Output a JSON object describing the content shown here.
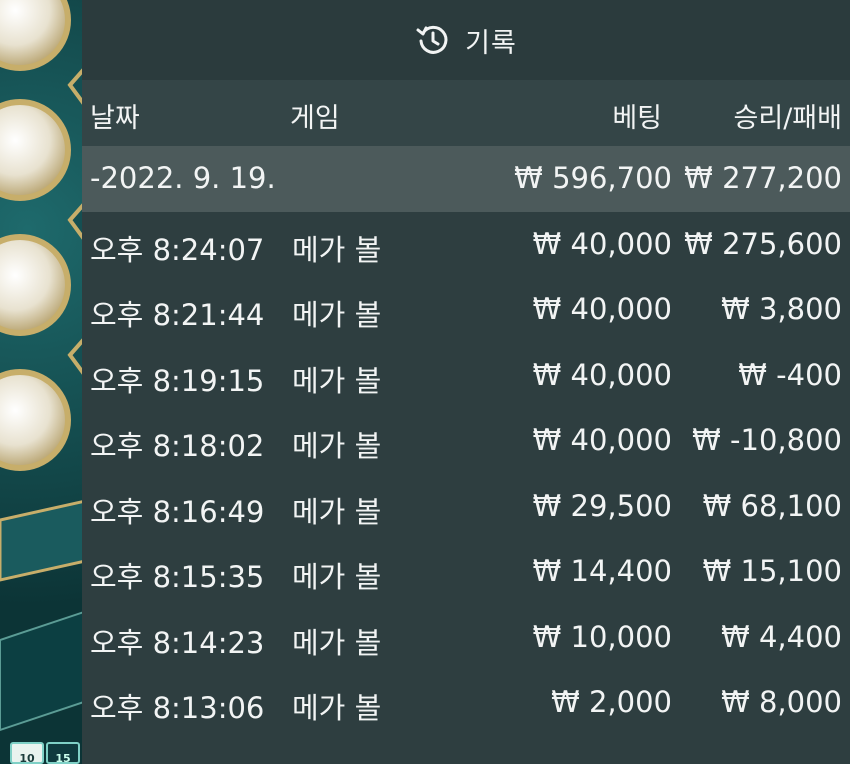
{
  "panel": {
    "title": "기록",
    "icon": "history-icon"
  },
  "columns": {
    "date": "날짜",
    "game": "게임",
    "bet": "베팅",
    "result": "승리/패배"
  },
  "total": {
    "date": "-2022. 9. 19.",
    "bet": "₩ 596,700",
    "result": "₩ 277,200"
  },
  "rows": [
    {
      "time": "오후 8:24:07",
      "game": "메가 볼",
      "bet": "₩ 40,000",
      "result": "₩ 275,600"
    },
    {
      "time": "오후 8:21:44",
      "game": "메가 볼",
      "bet": "₩ 40,000",
      "result": "₩ 3,800"
    },
    {
      "time": "오후 8:19:15",
      "game": "메가 볼",
      "bet": "₩ 40,000",
      "result": "₩ -400"
    },
    {
      "time": "오후 8:18:02",
      "game": "메가 볼",
      "bet": "₩ 40,000",
      "result": "₩ -10,800"
    },
    {
      "time": "오후 8:16:49",
      "game": "메가 볼",
      "bet": "₩ 29,500",
      "result": "₩ 68,100"
    },
    {
      "time": "오후 8:15:35",
      "game": "메가 볼",
      "bet": "₩ 14,400",
      "result": "₩ 15,100"
    },
    {
      "time": "오후 8:14:23",
      "game": "메가 볼",
      "bet": "₩ 10,000",
      "result": "₩ 4,400"
    },
    {
      "time": "오후 8:13:06",
      "game": "메가 볼",
      "bet": "₩ 2,000",
      "result": "₩ 8,000"
    }
  ],
  "background": {
    "chips": [
      "10",
      "15"
    ]
  },
  "colors": {
    "panel": "#2e3e40",
    "header_row": "#344547",
    "total_row": "#4c5a5b",
    "text": "#f2f4f4",
    "game_bg": "#0f3a3e"
  }
}
